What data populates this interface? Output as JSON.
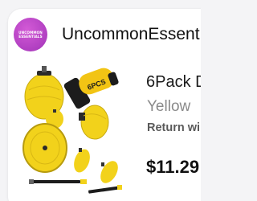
{
  "store": {
    "name": "UncommonEssenti",
    "logo_line1": "UNCOMMON",
    "logo_line2": "ESSENTIALS",
    "logo_color": "#b03fc1"
  },
  "product": {
    "title": "6Pack D",
    "variant": "Yellow",
    "return_text": "Return wi",
    "price": "$11.29",
    "image_badge": "6PCS",
    "image_icon": "drill-brush-kit-image",
    "brush_color": "#f2d21b"
  }
}
